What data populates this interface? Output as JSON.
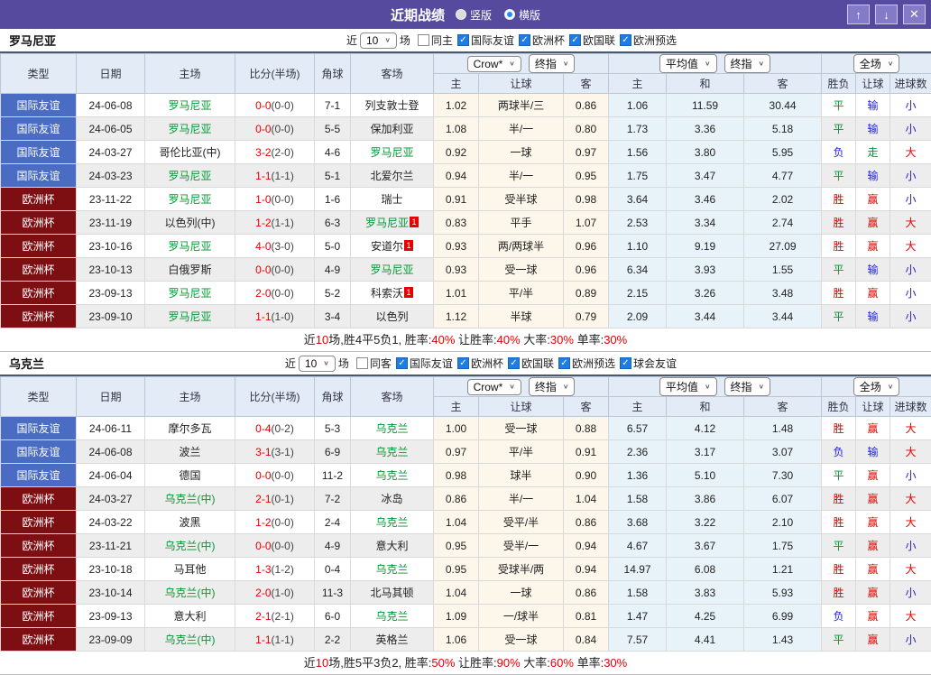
{
  "window": {
    "title": "近期战绩",
    "view_options": [
      {
        "label": "竖版",
        "selected": false
      },
      {
        "label": "横版",
        "selected": true
      }
    ],
    "buttons": {
      "up": "↑",
      "down": "↓",
      "close": "✕"
    }
  },
  "headers": {
    "type": "类型",
    "date": "日期",
    "home": "主场",
    "score": "比分(半场)",
    "corner": "角球",
    "away": "客场",
    "asian_home": "主",
    "asian_handicap": "让球",
    "asian_away": "客",
    "euro_home": "主",
    "euro_draw": "和",
    "euro_away": "客",
    "result": "胜负",
    "result_handicap": "让球",
    "result_goals": "进球数",
    "recent_prefix": "近",
    "games_suffix": "场"
  },
  "type_colors": {
    "国际友谊": "#4a6cc3",
    "欧洲杯": "#7d0f12"
  },
  "result_colors": {
    "胜": "#e60000",
    "赢": "#e60000",
    "大": "#e60000",
    "平": "#009933",
    "走": "#009933",
    "负": "#2222dd",
    "输": "#2222dd",
    "小": "#2222dd"
  },
  "sections": [
    {
      "title": "罗马尼亚",
      "controls": {
        "count": "10",
        "odds_source": "Crow*",
        "odds_term": "终指",
        "euro_source": "平均值",
        "euro_term": "终指",
        "scope": "全场"
      },
      "filters": [
        {
          "label": "同主",
          "checked": false
        },
        {
          "label": "国际友谊",
          "checked": true
        },
        {
          "label": "欧洲杯",
          "checked": true
        },
        {
          "label": "欧国联",
          "checked": true
        },
        {
          "label": "欧洲预选",
          "checked": true
        }
      ],
      "rows": [
        {
          "type": "国际友谊",
          "date": "24-06-08",
          "home": "罗马尼亚",
          "home_green": true,
          "score": "0-0",
          "half": "(0-0)",
          "corner": "7-1",
          "away": "列支敦士登",
          "asian": [
            "1.02",
            "两球半/三",
            "0.86"
          ],
          "euro": [
            "1.06",
            "11.59",
            "30.44"
          ],
          "res": [
            "平",
            "输",
            "小"
          ]
        },
        {
          "type": "国际友谊",
          "date": "24-06-05",
          "home": "罗马尼亚",
          "home_green": true,
          "score": "0-0",
          "half": "(0-0)",
          "corner": "5-5",
          "away": "保加利亚",
          "asian": [
            "1.08",
            "半/一",
            "0.80"
          ],
          "euro": [
            "1.73",
            "3.36",
            "5.18"
          ],
          "res": [
            "平",
            "输",
            "小"
          ]
        },
        {
          "type": "国际友谊",
          "date": "24-03-27",
          "home": "哥伦比亚(中)",
          "score": "3-2",
          "half": "(2-0)",
          "corner": "4-6",
          "away": "罗马尼亚",
          "away_green": true,
          "asian": [
            "0.92",
            "一球",
            "0.97"
          ],
          "euro": [
            "1.56",
            "3.80",
            "5.95"
          ],
          "res": [
            "负",
            "走",
            "大"
          ]
        },
        {
          "type": "国际友谊",
          "date": "24-03-23",
          "home": "罗马尼亚",
          "home_green": true,
          "score": "1-1",
          "half": "(1-1)",
          "corner": "5-1",
          "away": "北爱尔兰",
          "asian": [
            "0.94",
            "半/一",
            "0.95"
          ],
          "euro": [
            "1.75",
            "3.47",
            "4.77"
          ],
          "res": [
            "平",
            "输",
            "小"
          ]
        },
        {
          "type": "欧洲杯",
          "date": "23-11-22",
          "home": "罗马尼亚",
          "home_green": true,
          "score": "1-0",
          "half": "(0-0)",
          "corner": "1-6",
          "away": "瑞士",
          "asian": [
            "0.91",
            "受半球",
            "0.98"
          ],
          "euro": [
            "3.64",
            "3.46",
            "2.02"
          ],
          "res": [
            "胜",
            "赢",
            "小"
          ]
        },
        {
          "type": "欧洲杯",
          "date": "23-11-19",
          "home": "以色列(中)",
          "score": "1-2",
          "half": "(1-1)",
          "corner": "6-3",
          "away": "罗马尼亚",
          "away_green": true,
          "away_card": "1",
          "asian": [
            "0.83",
            "平手",
            "1.07"
          ],
          "euro": [
            "2.53",
            "3.34",
            "2.74"
          ],
          "res": [
            "胜",
            "赢",
            "大"
          ]
        },
        {
          "type": "欧洲杯",
          "date": "23-10-16",
          "home": "罗马尼亚",
          "home_green": true,
          "score": "4-0",
          "half": "(3-0)",
          "corner": "5-0",
          "away": "安道尔",
          "away_card": "1",
          "asian": [
            "0.93",
            "两/两球半",
            "0.96"
          ],
          "euro": [
            "1.10",
            "9.19",
            "27.09"
          ],
          "res": [
            "胜",
            "赢",
            "大"
          ]
        },
        {
          "type": "欧洲杯",
          "date": "23-10-13",
          "home": "白俄罗斯",
          "score": "0-0",
          "half": "(0-0)",
          "corner": "4-9",
          "away": "罗马尼亚",
          "away_green": true,
          "asian": [
            "0.93",
            "受一球",
            "0.96"
          ],
          "euro": [
            "6.34",
            "3.93",
            "1.55"
          ],
          "res": [
            "平",
            "输",
            "小"
          ]
        },
        {
          "type": "欧洲杯",
          "date": "23-09-13",
          "home": "罗马尼亚",
          "home_green": true,
          "score": "2-0",
          "half": "(0-0)",
          "corner": "5-2",
          "away": "科索沃",
          "away_card": "1",
          "asian": [
            "1.01",
            "平/半",
            "0.89"
          ],
          "euro": [
            "2.15",
            "3.26",
            "3.48"
          ],
          "res": [
            "胜",
            "赢",
            "小"
          ]
        },
        {
          "type": "欧洲杯",
          "date": "23-09-10",
          "home": "罗马尼亚",
          "home_green": true,
          "score": "1-1",
          "half": "(1-0)",
          "corner": "3-4",
          "away": "以色列",
          "asian": [
            "1.12",
            "半球",
            "0.79"
          ],
          "euro": [
            "2.09",
            "3.44",
            "3.44"
          ],
          "res": [
            "平",
            "输",
            "小"
          ]
        }
      ],
      "summary": [
        {
          "t": "近"
        },
        {
          "t": "10",
          "red": true
        },
        {
          "t": "场,胜4平5负1, 胜率:"
        },
        {
          "t": "40%",
          "red": true
        },
        {
          "t": " 让胜率:"
        },
        {
          "t": "40%",
          "red": true
        },
        {
          "t": " 大率:"
        },
        {
          "t": "30%",
          "red": true
        },
        {
          "t": " 单率:"
        },
        {
          "t": "30%",
          "red": true
        }
      ]
    },
    {
      "title": "乌克兰",
      "controls": {
        "count": "10",
        "odds_source": "Crow*",
        "odds_term": "终指",
        "euro_source": "平均值",
        "euro_term": "终指",
        "scope": "全场"
      },
      "filters": [
        {
          "label": "同客",
          "checked": false
        },
        {
          "label": "国际友谊",
          "checked": true
        },
        {
          "label": "欧洲杯",
          "checked": true
        },
        {
          "label": "欧国联",
          "checked": true
        },
        {
          "label": "欧洲预选",
          "checked": true
        },
        {
          "label": "球会友谊",
          "checked": true
        }
      ],
      "rows": [
        {
          "type": "国际友谊",
          "date": "24-06-11",
          "home": "摩尔多瓦",
          "score": "0-4",
          "half": "(0-2)",
          "corner": "5-3",
          "away": "乌克兰",
          "away_green": true,
          "asian": [
            "1.00",
            "受一球",
            "0.88"
          ],
          "euro": [
            "6.57",
            "4.12",
            "1.48"
          ],
          "res": [
            "胜",
            "赢",
            "大"
          ]
        },
        {
          "type": "国际友谊",
          "date": "24-06-08",
          "home": "波兰",
          "score": "3-1",
          "half": "(3-1)",
          "corner": "6-9",
          "away": "乌克兰",
          "away_green": true,
          "asian": [
            "0.97",
            "平/半",
            "0.91"
          ],
          "euro": [
            "2.36",
            "3.17",
            "3.07"
          ],
          "res": [
            "负",
            "输",
            "大"
          ]
        },
        {
          "type": "国际友谊",
          "date": "24-06-04",
          "home": "德国",
          "score": "0-0",
          "half": "(0-0)",
          "corner": "11-2",
          "away": "乌克兰",
          "away_green": true,
          "asian": [
            "0.98",
            "球半",
            "0.90"
          ],
          "euro": [
            "1.36",
            "5.10",
            "7.30"
          ],
          "res": [
            "平",
            "赢",
            "小"
          ]
        },
        {
          "type": "欧洲杯",
          "date": "24-03-27",
          "home": "乌克兰(中)",
          "home_green": true,
          "score": "2-1",
          "half": "(0-1)",
          "corner": "7-2",
          "away": "冰岛",
          "asian": [
            "0.86",
            "半/一",
            "1.04"
          ],
          "euro": [
            "1.58",
            "3.86",
            "6.07"
          ],
          "res": [
            "胜",
            "赢",
            "大"
          ]
        },
        {
          "type": "欧洲杯",
          "date": "24-03-22",
          "home": "波黑",
          "score": "1-2",
          "half": "(0-0)",
          "corner": "2-4",
          "away": "乌克兰",
          "away_green": true,
          "asian": [
            "1.04",
            "受平/半",
            "0.86"
          ],
          "euro": [
            "3.68",
            "3.22",
            "2.10"
          ],
          "res": [
            "胜",
            "赢",
            "大"
          ]
        },
        {
          "type": "欧洲杯",
          "date": "23-11-21",
          "home": "乌克兰(中)",
          "home_green": true,
          "score": "0-0",
          "half": "(0-0)",
          "corner": "4-9",
          "away": "意大利",
          "asian": [
            "0.95",
            "受半/一",
            "0.94"
          ],
          "euro": [
            "4.67",
            "3.67",
            "1.75"
          ],
          "res": [
            "平",
            "赢",
            "小"
          ]
        },
        {
          "type": "欧洲杯",
          "date": "23-10-18",
          "home": "马耳他",
          "score": "1-3",
          "half": "(1-2)",
          "corner": "0-4",
          "away": "乌克兰",
          "away_green": true,
          "asian": [
            "0.95",
            "受球半/两",
            "0.94"
          ],
          "euro": [
            "14.97",
            "6.08",
            "1.21"
          ],
          "res": [
            "胜",
            "赢",
            "大"
          ]
        },
        {
          "type": "欧洲杯",
          "date": "23-10-14",
          "home": "乌克兰(中)",
          "home_green": true,
          "score": "2-0",
          "half": "(1-0)",
          "corner": "11-3",
          "away": "北马其顿",
          "asian": [
            "1.04",
            "一球",
            "0.86"
          ],
          "euro": [
            "1.58",
            "3.83",
            "5.93"
          ],
          "res": [
            "胜",
            "赢",
            "小"
          ]
        },
        {
          "type": "欧洲杯",
          "date": "23-09-13",
          "home": "意大利",
          "score": "2-1",
          "half": "(2-1)",
          "corner": "6-0",
          "away": "乌克兰",
          "away_green": true,
          "asian": [
            "1.09",
            "一/球半",
            "0.81"
          ],
          "euro": [
            "1.47",
            "4.25",
            "6.99"
          ],
          "res": [
            "负",
            "赢",
            "大"
          ]
        },
        {
          "type": "欧洲杯",
          "date": "23-09-09",
          "home": "乌克兰(中)",
          "home_green": true,
          "score": "1-1",
          "half": "(1-1)",
          "corner": "2-2",
          "away": "英格兰",
          "asian": [
            "1.06",
            "受一球",
            "0.84"
          ],
          "euro": [
            "7.57",
            "4.41",
            "1.43"
          ],
          "res": [
            "平",
            "赢",
            "小"
          ]
        }
      ],
      "summary": [
        {
          "t": "近"
        },
        {
          "t": "10",
          "red": true
        },
        {
          "t": "场,胜5平3负2, 胜率:"
        },
        {
          "t": "50%",
          "red": true
        },
        {
          "t": " 让胜率:"
        },
        {
          "t": "90%",
          "red": true
        },
        {
          "t": " 大率:"
        },
        {
          "t": "60%",
          "red": true
        },
        {
          "t": " 单率:"
        },
        {
          "t": "30%",
          "red": true
        }
      ]
    }
  ]
}
